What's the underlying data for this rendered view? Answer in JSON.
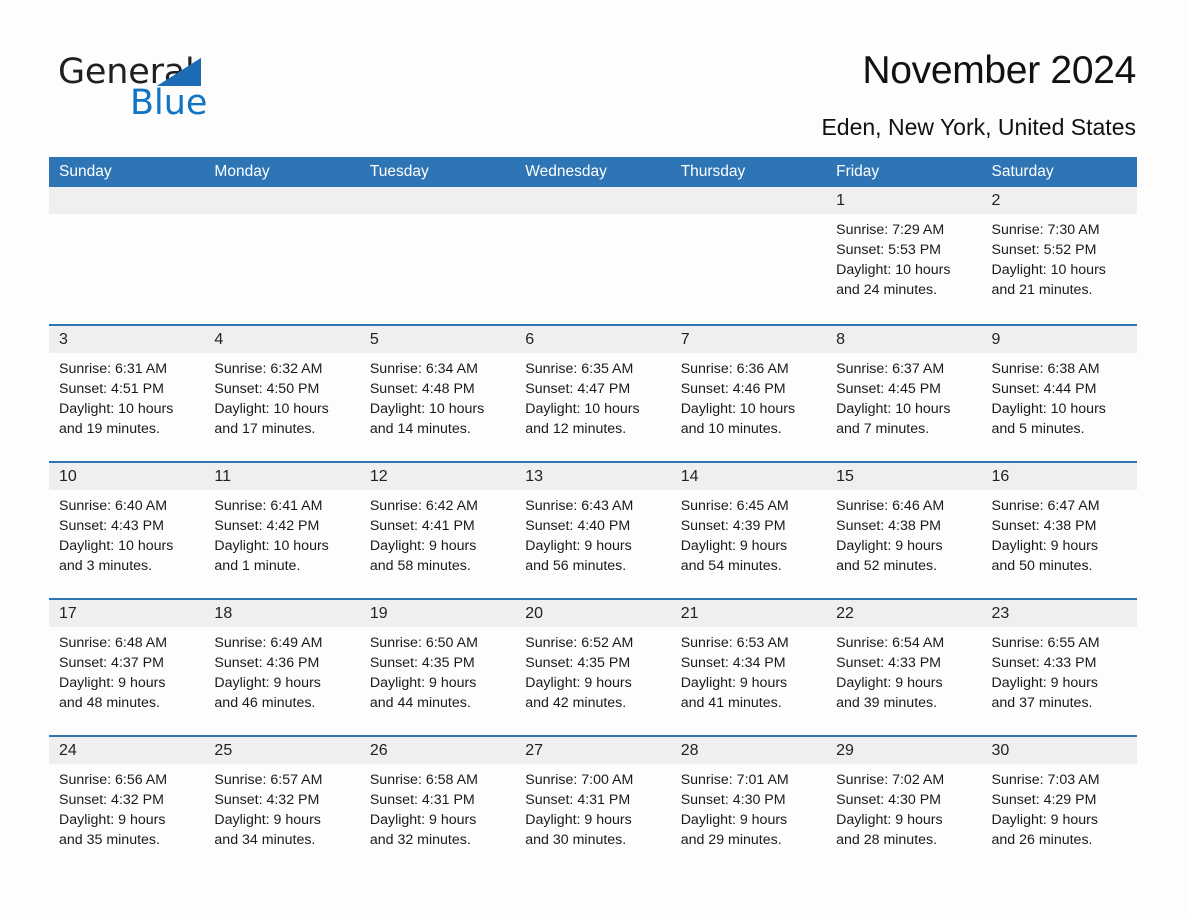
{
  "brand": {
    "name_part1": "General",
    "name_part2": "Blue",
    "logo_icon": "triangle-icon",
    "accent_blue": "#1175c4"
  },
  "header": {
    "title": "November 2024",
    "location": "Eden, New York, United States"
  },
  "calendar": {
    "header_color": "#2e75b6",
    "daynum_band_color": "#efefef",
    "weekdays": [
      "Sunday",
      "Monday",
      "Tuesday",
      "Wednesday",
      "Thursday",
      "Friday",
      "Saturday"
    ],
    "weeks": [
      [
        {
          "day": "",
          "empty": true,
          "sunrise": "",
          "sunset": "",
          "daylight1": "",
          "daylight2": ""
        },
        {
          "day": "",
          "empty": true,
          "sunrise": "",
          "sunset": "",
          "daylight1": "",
          "daylight2": ""
        },
        {
          "day": "",
          "empty": true,
          "sunrise": "",
          "sunset": "",
          "daylight1": "",
          "daylight2": ""
        },
        {
          "day": "",
          "empty": true,
          "sunrise": "",
          "sunset": "",
          "daylight1": "",
          "daylight2": ""
        },
        {
          "day": "",
          "empty": true,
          "sunrise": "",
          "sunset": "",
          "daylight1": "",
          "daylight2": ""
        },
        {
          "day": "1",
          "empty": false,
          "sunrise": "Sunrise: 7:29 AM",
          "sunset": "Sunset: 5:53 PM",
          "daylight1": "Daylight: 10 hours",
          "daylight2": "and 24 minutes."
        },
        {
          "day": "2",
          "empty": false,
          "sunrise": "Sunrise: 7:30 AM",
          "sunset": "Sunset: 5:52 PM",
          "daylight1": "Daylight: 10 hours",
          "daylight2": "and 21 minutes."
        }
      ],
      [
        {
          "day": "3",
          "empty": false,
          "sunrise": "Sunrise: 6:31 AM",
          "sunset": "Sunset: 4:51 PM",
          "daylight1": "Daylight: 10 hours",
          "daylight2": "and 19 minutes."
        },
        {
          "day": "4",
          "empty": false,
          "sunrise": "Sunrise: 6:32 AM",
          "sunset": "Sunset: 4:50 PM",
          "daylight1": "Daylight: 10 hours",
          "daylight2": "and 17 minutes."
        },
        {
          "day": "5",
          "empty": false,
          "sunrise": "Sunrise: 6:34 AM",
          "sunset": "Sunset: 4:48 PM",
          "daylight1": "Daylight: 10 hours",
          "daylight2": "and 14 minutes."
        },
        {
          "day": "6",
          "empty": false,
          "sunrise": "Sunrise: 6:35 AM",
          "sunset": "Sunset: 4:47 PM",
          "daylight1": "Daylight: 10 hours",
          "daylight2": "and 12 minutes."
        },
        {
          "day": "7",
          "empty": false,
          "sunrise": "Sunrise: 6:36 AM",
          "sunset": "Sunset: 4:46 PM",
          "daylight1": "Daylight: 10 hours",
          "daylight2": "and 10 minutes."
        },
        {
          "day": "8",
          "empty": false,
          "sunrise": "Sunrise: 6:37 AM",
          "sunset": "Sunset: 4:45 PM",
          "daylight1": "Daylight: 10 hours",
          "daylight2": "and 7 minutes."
        },
        {
          "day": "9",
          "empty": false,
          "sunrise": "Sunrise: 6:38 AM",
          "sunset": "Sunset: 4:44 PM",
          "daylight1": "Daylight: 10 hours",
          "daylight2": "and 5 minutes."
        }
      ],
      [
        {
          "day": "10",
          "empty": false,
          "sunrise": "Sunrise: 6:40 AM",
          "sunset": "Sunset: 4:43 PM",
          "daylight1": "Daylight: 10 hours",
          "daylight2": "and 3 minutes."
        },
        {
          "day": "11",
          "empty": false,
          "sunrise": "Sunrise: 6:41 AM",
          "sunset": "Sunset: 4:42 PM",
          "daylight1": "Daylight: 10 hours",
          "daylight2": "and 1 minute."
        },
        {
          "day": "12",
          "empty": false,
          "sunrise": "Sunrise: 6:42 AM",
          "sunset": "Sunset: 4:41 PM",
          "daylight1": "Daylight: 9 hours",
          "daylight2": "and 58 minutes."
        },
        {
          "day": "13",
          "empty": false,
          "sunrise": "Sunrise: 6:43 AM",
          "sunset": "Sunset: 4:40 PM",
          "daylight1": "Daylight: 9 hours",
          "daylight2": "and 56 minutes."
        },
        {
          "day": "14",
          "empty": false,
          "sunrise": "Sunrise: 6:45 AM",
          "sunset": "Sunset: 4:39 PM",
          "daylight1": "Daylight: 9 hours",
          "daylight2": "and 54 minutes."
        },
        {
          "day": "15",
          "empty": false,
          "sunrise": "Sunrise: 6:46 AM",
          "sunset": "Sunset: 4:38 PM",
          "daylight1": "Daylight: 9 hours",
          "daylight2": "and 52 minutes."
        },
        {
          "day": "16",
          "empty": false,
          "sunrise": "Sunrise: 6:47 AM",
          "sunset": "Sunset: 4:38 PM",
          "daylight1": "Daylight: 9 hours",
          "daylight2": "and 50 minutes."
        }
      ],
      [
        {
          "day": "17",
          "empty": false,
          "sunrise": "Sunrise: 6:48 AM",
          "sunset": "Sunset: 4:37 PM",
          "daylight1": "Daylight: 9 hours",
          "daylight2": "and 48 minutes."
        },
        {
          "day": "18",
          "empty": false,
          "sunrise": "Sunrise: 6:49 AM",
          "sunset": "Sunset: 4:36 PM",
          "daylight1": "Daylight: 9 hours",
          "daylight2": "and 46 minutes."
        },
        {
          "day": "19",
          "empty": false,
          "sunrise": "Sunrise: 6:50 AM",
          "sunset": "Sunset: 4:35 PM",
          "daylight1": "Daylight: 9 hours",
          "daylight2": "and 44 minutes."
        },
        {
          "day": "20",
          "empty": false,
          "sunrise": "Sunrise: 6:52 AM",
          "sunset": "Sunset: 4:35 PM",
          "daylight1": "Daylight: 9 hours",
          "daylight2": "and 42 minutes."
        },
        {
          "day": "21",
          "empty": false,
          "sunrise": "Sunrise: 6:53 AM",
          "sunset": "Sunset: 4:34 PM",
          "daylight1": "Daylight: 9 hours",
          "daylight2": "and 41 minutes."
        },
        {
          "day": "22",
          "empty": false,
          "sunrise": "Sunrise: 6:54 AM",
          "sunset": "Sunset: 4:33 PM",
          "daylight1": "Daylight: 9 hours",
          "daylight2": "and 39 minutes."
        },
        {
          "day": "23",
          "empty": false,
          "sunrise": "Sunrise: 6:55 AM",
          "sunset": "Sunset: 4:33 PM",
          "daylight1": "Daylight: 9 hours",
          "daylight2": "and 37 minutes."
        }
      ],
      [
        {
          "day": "24",
          "empty": false,
          "sunrise": "Sunrise: 6:56 AM",
          "sunset": "Sunset: 4:32 PM",
          "daylight1": "Daylight: 9 hours",
          "daylight2": "and 35 minutes."
        },
        {
          "day": "25",
          "empty": false,
          "sunrise": "Sunrise: 6:57 AM",
          "sunset": "Sunset: 4:32 PM",
          "daylight1": "Daylight: 9 hours",
          "daylight2": "and 34 minutes."
        },
        {
          "day": "26",
          "empty": false,
          "sunrise": "Sunrise: 6:58 AM",
          "sunset": "Sunset: 4:31 PM",
          "daylight1": "Daylight: 9 hours",
          "daylight2": "and 32 minutes."
        },
        {
          "day": "27",
          "empty": false,
          "sunrise": "Sunrise: 7:00 AM",
          "sunset": "Sunset: 4:31 PM",
          "daylight1": "Daylight: 9 hours",
          "daylight2": "and 30 minutes."
        },
        {
          "day": "28",
          "empty": false,
          "sunrise": "Sunrise: 7:01 AM",
          "sunset": "Sunset: 4:30 PM",
          "daylight1": "Daylight: 9 hours",
          "daylight2": "and 29 minutes."
        },
        {
          "day": "29",
          "empty": false,
          "sunrise": "Sunrise: 7:02 AM",
          "sunset": "Sunset: 4:30 PM",
          "daylight1": "Daylight: 9 hours",
          "daylight2": "and 28 minutes."
        },
        {
          "day": "30",
          "empty": false,
          "sunrise": "Sunrise: 7:03 AM",
          "sunset": "Sunset: 4:29 PM",
          "daylight1": "Daylight: 9 hours",
          "daylight2": "and 26 minutes."
        }
      ]
    ]
  }
}
